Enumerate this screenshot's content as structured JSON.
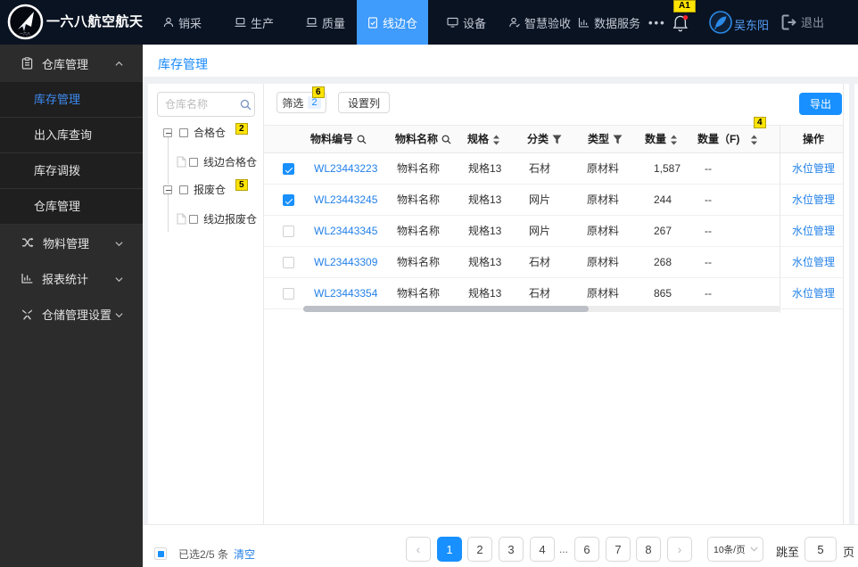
{
  "topbar": {
    "brand": "一六八航空航天",
    "nav_items": [
      {
        "label": "销采"
      },
      {
        "label": "生产"
      },
      {
        "label": "质量"
      },
      {
        "label": "线边仓"
      },
      {
        "label": "设备"
      },
      {
        "label": "智慧验收"
      },
      {
        "label": "数据服务"
      }
    ],
    "more": "•••",
    "bell_som": "A1",
    "username": "吴东阳",
    "logout_label": "退出"
  },
  "sidebar": {
    "group1": {
      "label": "仓库管理"
    },
    "group1_children": [
      {
        "label": "库存管理"
      },
      {
        "label": "出入库查询"
      },
      {
        "label": "库存调拨"
      },
      {
        "label": "仓库管理"
      }
    ],
    "group2": {
      "label": "物料管理"
    },
    "group3": {
      "label": "报表统计"
    },
    "group4": {
      "label": "仓储管理设置"
    }
  },
  "tab": {
    "label": "库存管理"
  },
  "tree": {
    "search_placeholder": "仓库名称",
    "node1": {
      "label": "合格仓",
      "som": "2"
    },
    "node1_child": {
      "label": "线边合格仓"
    },
    "node2": {
      "label": "报废仓",
      "som": "5"
    },
    "node2_child": {
      "label": "线边报废仓"
    }
  },
  "toolbar": {
    "filter_label": "筛选",
    "filter_count": "2",
    "filter_som": "6",
    "columns_label": "设置列",
    "export_label": "导出"
  },
  "table": {
    "qty_f_som": "4",
    "headers": {
      "code": "物料编号",
      "name": "物料名称",
      "spec": "规格",
      "category": "分类",
      "type": "类型",
      "qty": "数量",
      "qty_f": "数量（F)",
      "action": "操作"
    },
    "rows": [
      {
        "checked": true,
        "code": "WL23443223",
        "name": "物料名称",
        "spec": "规格13",
        "category": "石材",
        "type": "原材料",
        "qty": "1,587",
        "qty_f": "--",
        "action": "水位管理"
      },
      {
        "checked": true,
        "code": "WL23443245",
        "name": "物料名称",
        "spec": "规格13",
        "category": "网片",
        "type": "原材料",
        "qty": "244",
        "qty_f": "--",
        "action": "水位管理"
      },
      {
        "checked": false,
        "code": "WL23443345",
        "name": "物料名称",
        "spec": "规格13",
        "category": "网片",
        "type": "原材料",
        "qty": "267",
        "qty_f": "--",
        "action": "水位管理"
      },
      {
        "checked": false,
        "code": "WL23443309",
        "name": "物料名称",
        "spec": "规格13",
        "category": "石材",
        "type": "原材料",
        "qty": "268",
        "qty_f": "--",
        "action": "水位管理"
      },
      {
        "checked": false,
        "code": "WL23443354",
        "name": "物料名称",
        "spec": "规格13",
        "category": "石材",
        "type": "原材料",
        "qty": "865",
        "qty_f": "--",
        "action": "水位管理"
      }
    ]
  },
  "footer": {
    "selected_text": "已选2/5 条",
    "clear_label": "清空",
    "pages": [
      "1",
      "2",
      "3",
      "4",
      "6",
      "7",
      "8"
    ],
    "ellipsis": "...",
    "page_size": "10条/页",
    "jump_label": "跳至",
    "jump_value": "5",
    "unit_label": "页"
  },
  "colors": {
    "accent": "#1890ff",
    "topbar_bg": "#0a1322",
    "sidebar_bg": "#2c2c2c",
    "som_yellow": "#ffe403",
    "active_nav_bg": "#3f9bfc"
  }
}
